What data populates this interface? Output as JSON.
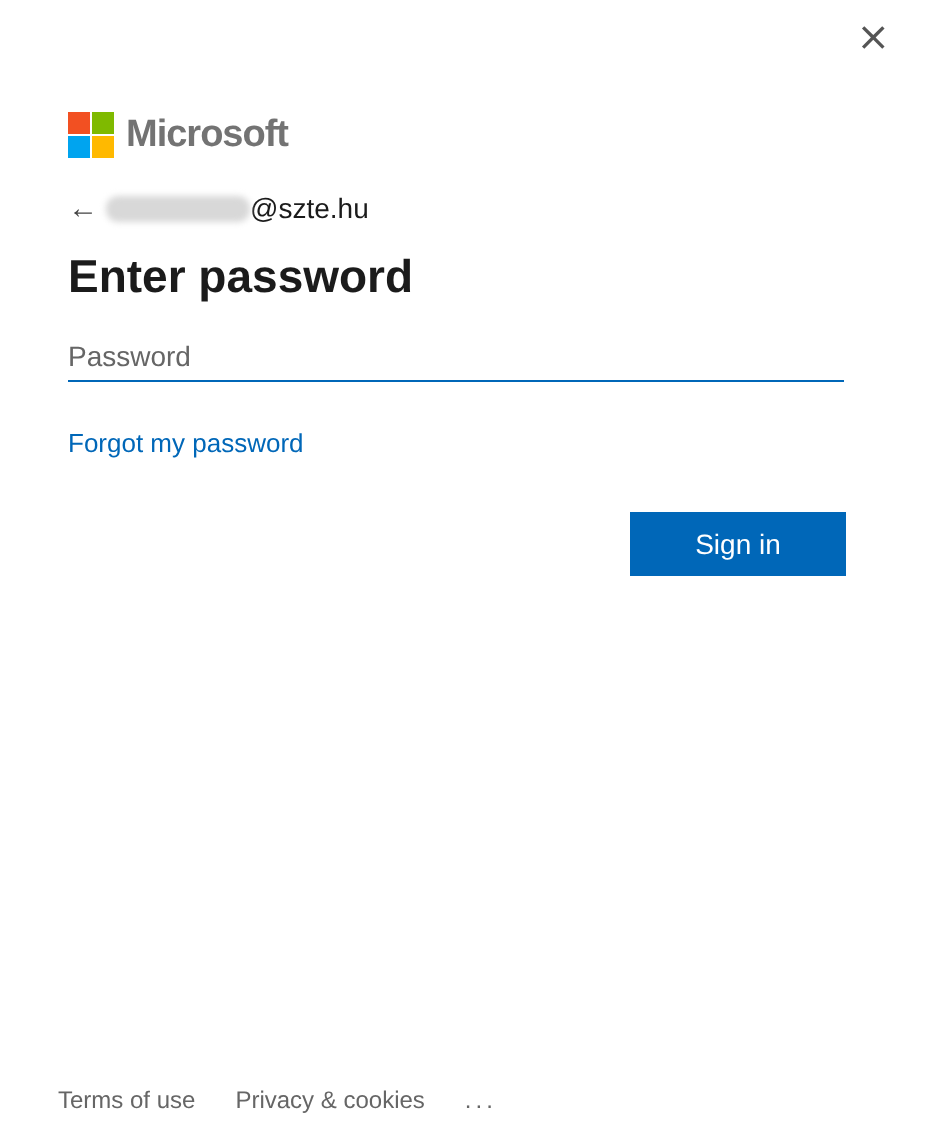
{
  "close": "×",
  "brand": "Microsoft",
  "back": "←",
  "account": "@szte.hu",
  "heading": "Enter password",
  "password": {
    "placeholder": "Password"
  },
  "forgot_link": "Forgot my password",
  "sign_in": "Sign in",
  "footer": [
    "Terms of use",
    "Privacy & cookies",
    "..."
  ]
}
